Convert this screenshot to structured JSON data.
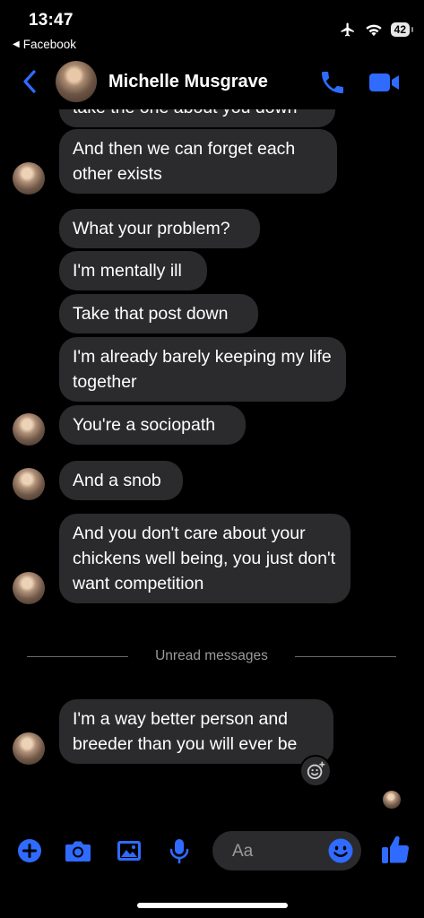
{
  "status_bar": {
    "time": "13:47",
    "back_app": "Facebook",
    "battery": "42"
  },
  "header": {
    "contact_name": "Michelle Musgrave"
  },
  "messages": [
    {
      "text": "take the one about you down"
    },
    {
      "text": "And then we can forget each other exists"
    },
    {
      "text": "What your problem?"
    },
    {
      "text": "I'm mentally ill"
    },
    {
      "text": "Take that post down"
    },
    {
      "text": "I'm already barely keeping my life together"
    },
    {
      "text": "You're a sociopath"
    },
    {
      "text": "And a snob"
    },
    {
      "text": "And you don't care about your chickens well being, you just don't want competition"
    },
    {
      "text": "I'm a way better person and breeder than you will ever be"
    }
  ],
  "divider": {
    "label": "Unread messages"
  },
  "composer": {
    "placeholder": "Aa"
  },
  "colors": {
    "accent": "#2f6bff",
    "bubble": "#2b2b2d",
    "background": "#000000"
  },
  "icons": [
    "chevron-left-icon",
    "phone-icon",
    "video-camera-icon",
    "plus-icon",
    "camera-icon",
    "image-icon",
    "microphone-icon",
    "emoji-icon",
    "thumbs-up-icon",
    "add-reaction-icon"
  ]
}
